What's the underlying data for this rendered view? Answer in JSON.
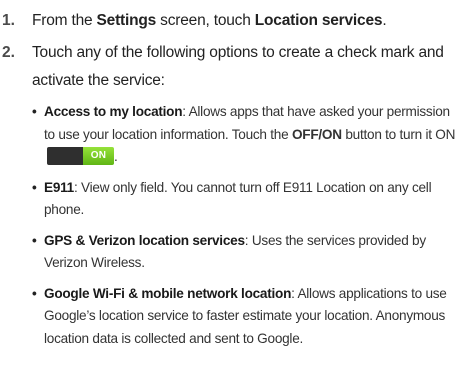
{
  "steps": [
    {
      "number": "1.",
      "parts": [
        "From the ",
        "Settings",
        " screen, touch ",
        "Location services",
        "."
      ]
    },
    {
      "number": "2.",
      "text": "Touch any of the following options to create a check mark and activate the service:",
      "bullets": [
        {
          "title": "Access to my location",
          "text": ": Allows apps that have asked your permission to use your location information. Touch the ",
          "bold2": "OFF/ON",
          "text2": " button to turn it ON",
          "tail": "."
        },
        {
          "title": "E911",
          "text": ": View only field. You cannot turn off E911 Location on any cell phone."
        },
        {
          "title": "GPS & Verizon location services",
          "text": ": Uses the services provided by Verizon Wireless."
        },
        {
          "title": "Google Wi-Fi & mobile network location",
          "text": ": Allows applications to use Google’s location service to faster estimate your location. Anonymous location data is collected and sent to Google."
        }
      ]
    }
  ],
  "toggle": {
    "label": "ON",
    "state": "on",
    "on_color": "#7ed321",
    "off_color": "#2f2f2f"
  },
  "bullet_symbol": "•"
}
